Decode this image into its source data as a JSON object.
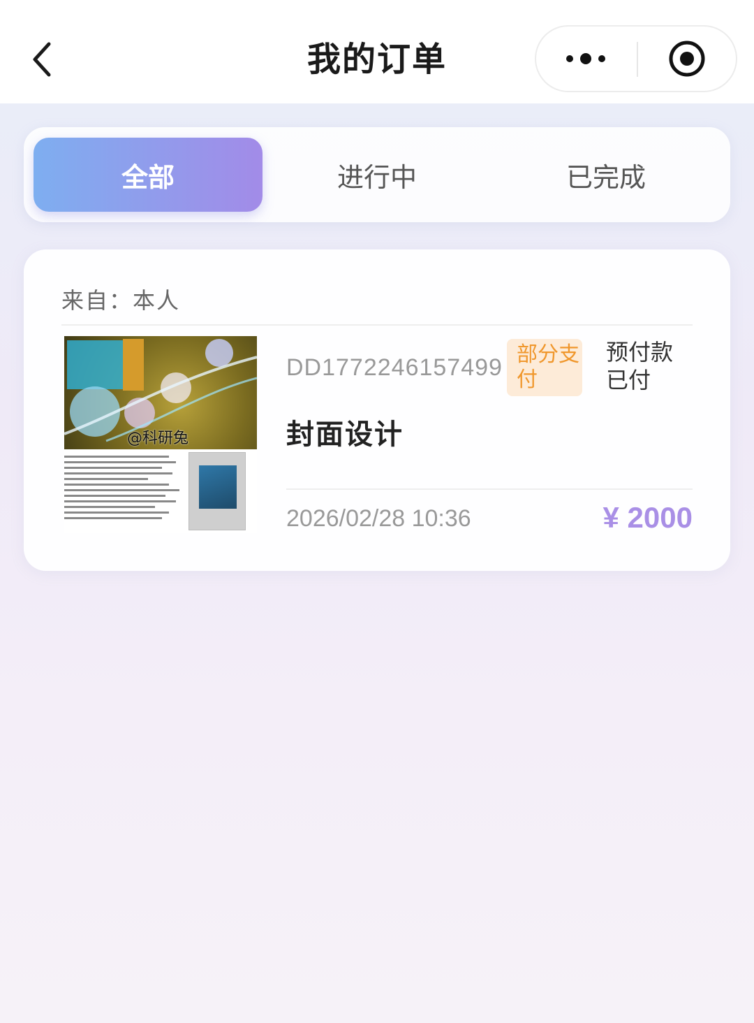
{
  "nav": {
    "title": "我的订单",
    "back_icon": "chevron-left-icon",
    "more_icon": "more-dots-icon",
    "close_icon": "target-circle-icon"
  },
  "tabs": [
    {
      "label": "全部",
      "active": true
    },
    {
      "label": "进行中",
      "active": false
    },
    {
      "label": "已完成",
      "active": false
    }
  ],
  "order": {
    "from_label": "来自：本人",
    "thumbnail_watermark": "@科研兔",
    "order_number": "DD1772246157499",
    "status_badge": "部分支付",
    "payment_status": "预付款已付",
    "product_name": "封面设计",
    "time": "2026/02/28 10:36",
    "price": "¥ 2000",
    "colors": {
      "badge_bg": "#fdebd8",
      "badge_text": "#f0972c",
      "price": "#a98fe6",
      "tab_gradient_start": "#7eaef0",
      "tab_gradient_end": "#a28be8"
    }
  }
}
